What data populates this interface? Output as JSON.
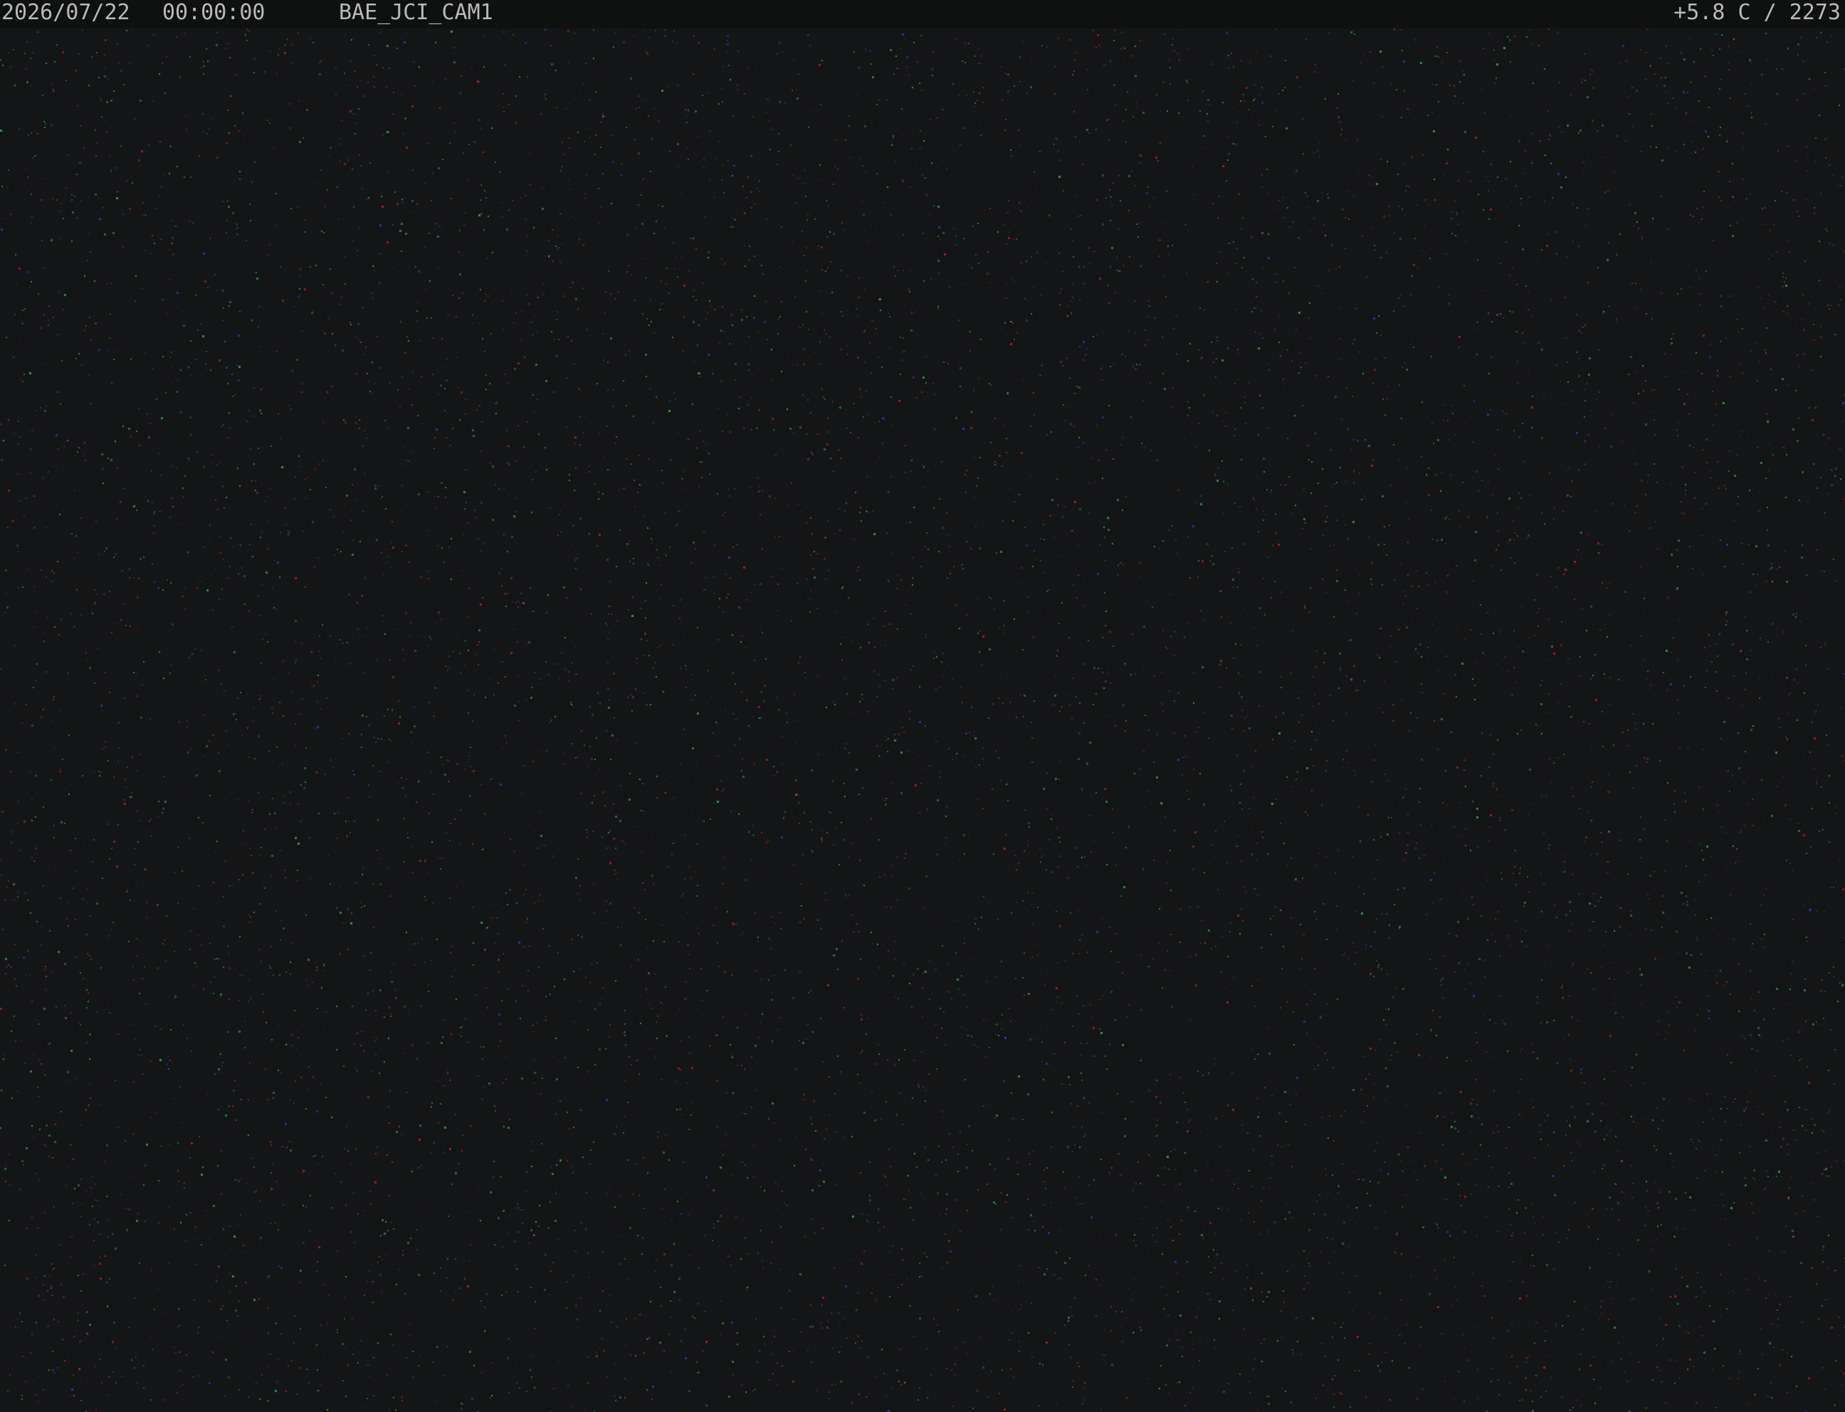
{
  "osd": {
    "date": "2026/07/22",
    "time": "00:00:00",
    "camera_name": "BAE_JCI_CAM1",
    "temperature": "+5.8 C",
    "separator": "/",
    "frame_counter": "2273",
    "text_color": "#b9b9b9"
  },
  "scene": {
    "background_color": "#141516",
    "noise_colors": [
      "#ff2a3a",
      "#3a4aff",
      "#3aff5a",
      "#8a8a8a"
    ]
  }
}
